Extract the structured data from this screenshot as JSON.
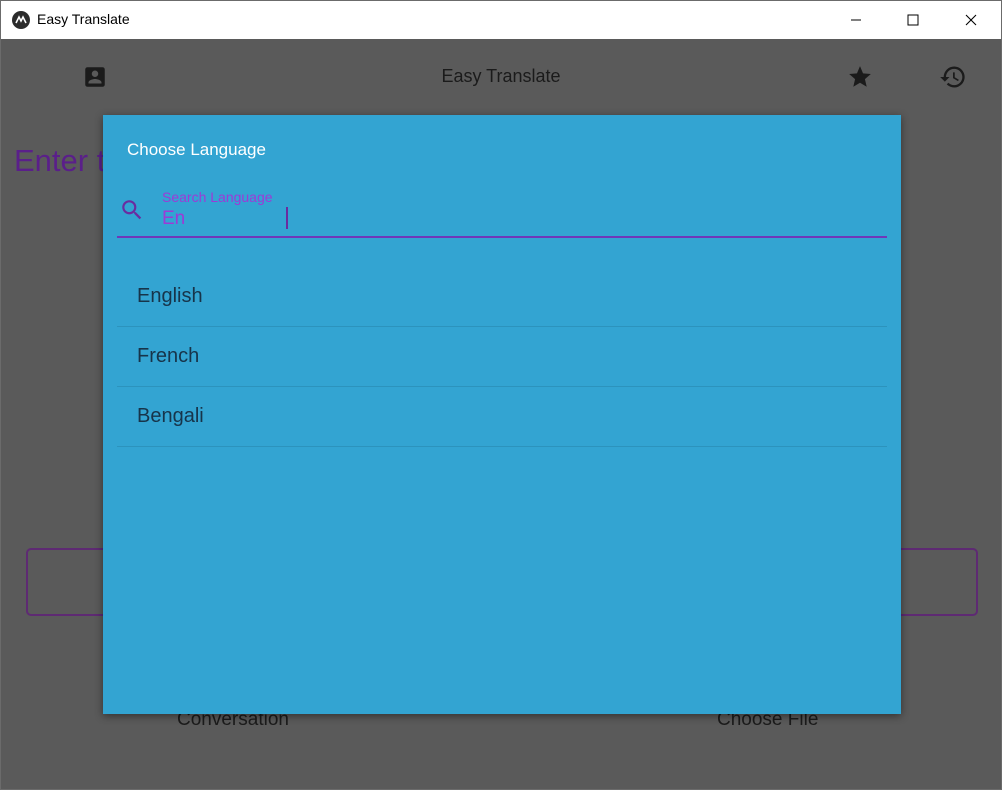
{
  "window": {
    "title": "Easy Translate"
  },
  "toolbar": {
    "title": "Easy Translate",
    "icons": {
      "account": "account-box-icon",
      "favorites": "star-icon",
      "history": "history-icon"
    }
  },
  "main": {
    "prompt_text": "Enter t",
    "buttons": {
      "conversation": "Conversation",
      "choose_file": "Choose File"
    }
  },
  "dialog": {
    "title": "Choose Language",
    "search": {
      "label": "Search Language",
      "value": "En"
    },
    "languages": [
      {
        "label": "English"
      },
      {
        "label": "French"
      },
      {
        "label": "Bengali"
      }
    ]
  },
  "colors": {
    "dialog_bg": "#33a4d2",
    "accent": "#9d3ad6",
    "backdrop": "#5a5a5a",
    "prompt_text": "#5a1f8a"
  }
}
